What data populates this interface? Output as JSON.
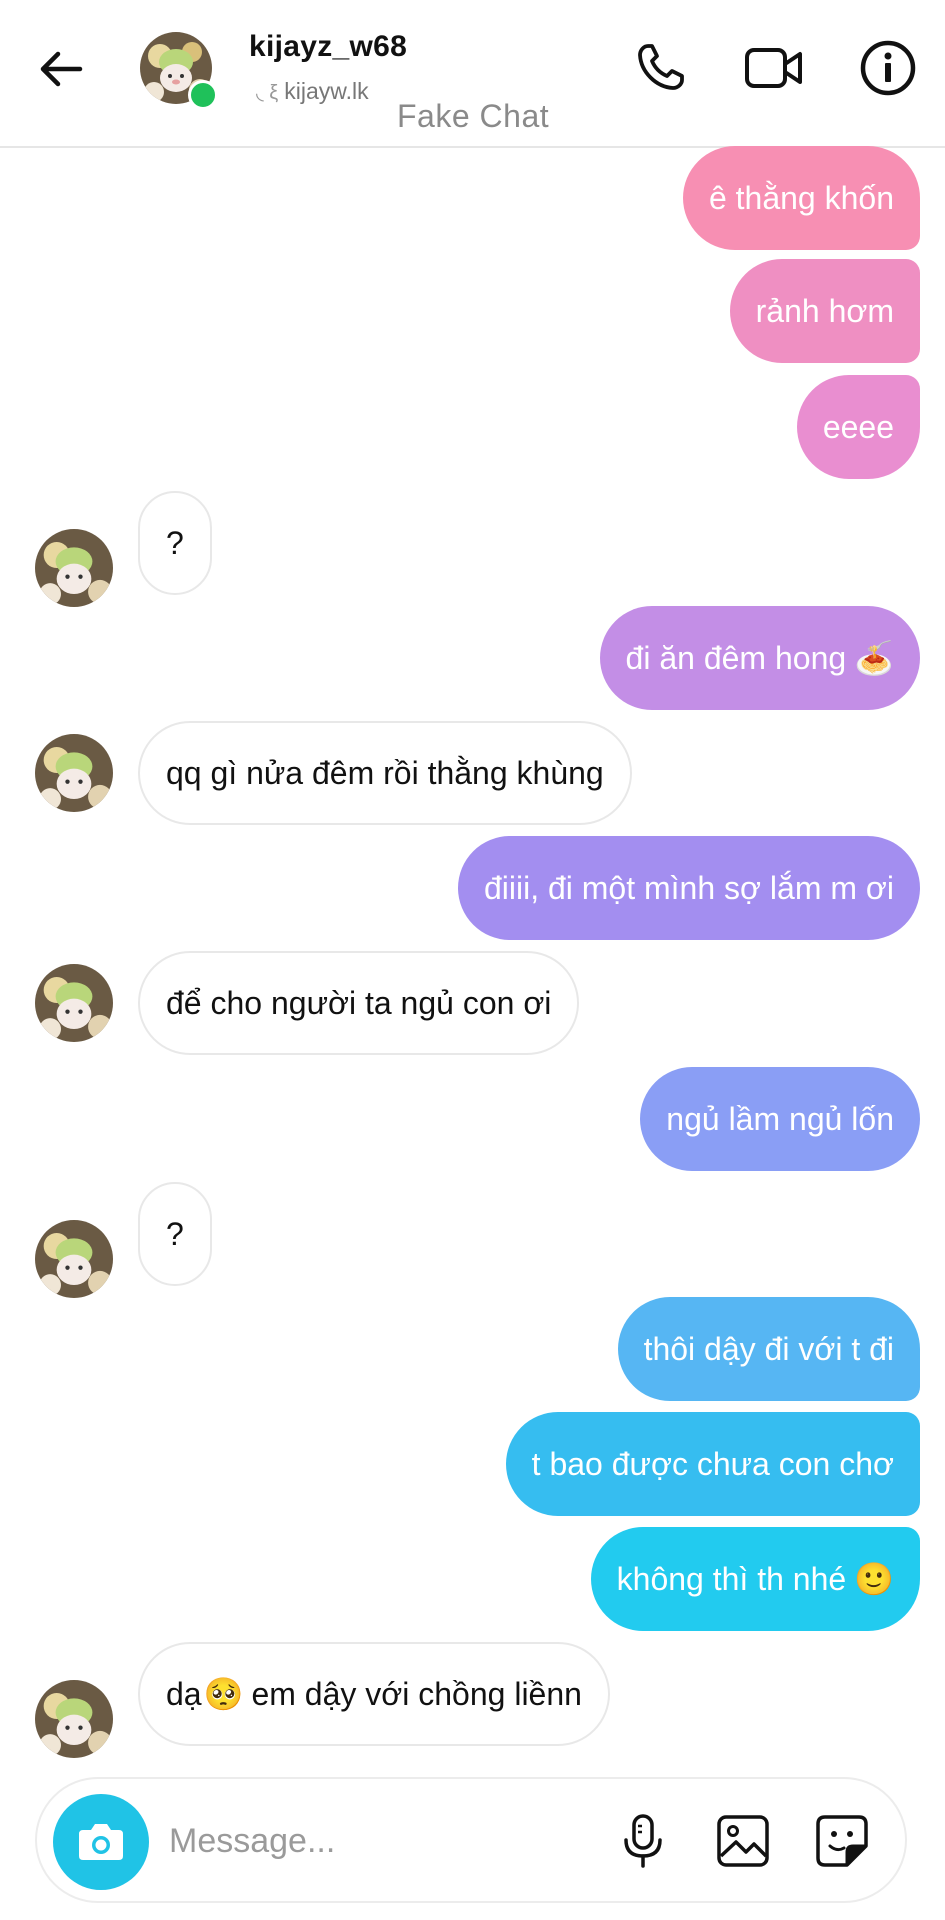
{
  "header": {
    "username": "kijayz_w68",
    "handle": "kijayw.lk",
    "handle_prefix": "◟ ξ",
    "watermark": "Fake Chat",
    "online": true
  },
  "icons": {
    "back": "arrow-left-icon",
    "call": "phone-icon",
    "video": "video-camera-icon",
    "info": "info-icon",
    "camera": "camera-icon",
    "mic": "microphone-icon",
    "gallery": "image-icon",
    "sticker": "sticker-icon"
  },
  "messages": [
    {
      "side": "out",
      "text": "ê thằng khốn",
      "color": "#f78fb3"
    },
    {
      "side": "out",
      "text": "rảnh hơm",
      "color": "#ef8fc2"
    },
    {
      "side": "out",
      "text": "eeee",
      "color": "#e98ed0"
    },
    {
      "side": "in",
      "text": "?"
    },
    {
      "side": "out",
      "text": "đi ăn đêm hong",
      "emoji": "🍝",
      "color": "#c38ee6"
    },
    {
      "side": "in",
      "text": "qq gì nửa đêm rồi thằng khùng"
    },
    {
      "side": "out",
      "text": "điiii, đi một mình sợ lắm m ơi",
      "color": "#a38ef0"
    },
    {
      "side": "in",
      "text": "để cho người ta ngủ con ơi"
    },
    {
      "side": "out",
      "text": "ngủ lầm ngủ lốn",
      "color": "#8a9ef5"
    },
    {
      "side": "in",
      "text": "?"
    },
    {
      "side": "out",
      "text": "thôi dậy đi với t đi",
      "color": "#56b6f3"
    },
    {
      "side": "out",
      "text": "t bao được chưa con chơ",
      "color": "#36bdf0"
    },
    {
      "side": "out",
      "text": "không thì th nhé",
      "emoji": "🙂",
      "color": "#22cbef"
    },
    {
      "side": "in",
      "text": "dạ",
      "emoji": "🥺",
      "text2": "em dậy với chồng liềnn"
    }
  ],
  "composer": {
    "placeholder": "Message..."
  },
  "colors": {
    "online": "#1fc15a",
    "camera_button": "#20c3e6"
  }
}
